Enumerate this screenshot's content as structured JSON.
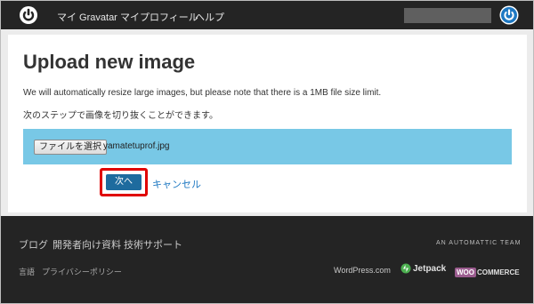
{
  "nav": {
    "logo_icon": "gravatar-power-icon",
    "items": [
      {
        "label": "マイ Gravatar"
      },
      {
        "label": "マイプロフィール"
      },
      {
        "label": "ヘルプ"
      }
    ],
    "user_menu_icon": "power-icon"
  },
  "main": {
    "title": "Upload new image",
    "description1": "We will automatically resize large images, but please note that there is a 1MB file size limit.",
    "description2": "次のステップで画像を切り抜くことができます。",
    "file_button_label": "ファイルを選択",
    "file_name": "yamatetuprof.jpg",
    "next_label": "次へ",
    "cancel_label": "キャンセル"
  },
  "footer": {
    "links": [
      {
        "label": "ブログ"
      },
      {
        "label": "開発者向け資料"
      },
      {
        "label": "技術サポート"
      }
    ],
    "bottom_links": [
      {
        "label": "言語"
      },
      {
        "label": "プライバシーポリシー"
      }
    ],
    "automattic": "AN AUTOMATTIC TEAM",
    "brands": {
      "wordpress": "WordPress.com",
      "jetpack": "Jetpack",
      "woo_badge": "WOO",
      "woo_text": "COMMERCE"
    }
  },
  "colors": {
    "topbar": "#242424",
    "upload_bar": "#78c8e6",
    "primary_button": "#1e6b9e",
    "highlight_outline": "#e00000",
    "link": "#1e78c2"
  }
}
